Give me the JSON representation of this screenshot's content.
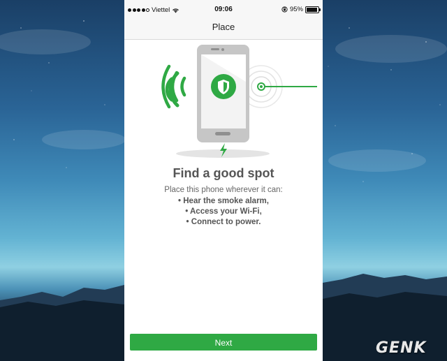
{
  "status_bar": {
    "carrier": "Viettel",
    "time": "09:06",
    "battery": "95%",
    "battery_level": 0.95,
    "icons": [
      "signal-dots-icon",
      "wifi-icon",
      "rotation-lock-icon",
      "battery-icon"
    ]
  },
  "nav": {
    "title": "Place"
  },
  "illustration": {
    "icons": [
      "phone-icon",
      "shield-icon",
      "wifi-waves-icon",
      "smoke-alarm-sound-icon",
      "power-bolt-icon"
    ],
    "accent": "#2fa944"
  },
  "content": {
    "heading": "Find a good spot",
    "subtext": "Place this phone wherever it can:",
    "requirements": [
      "Hear the smoke alarm,",
      "Access your Wi-Fi,",
      "Connect to power."
    ]
  },
  "button": {
    "next_label": "Next",
    "color": "#2fa944"
  },
  "watermark": {
    "text": "GENK"
  }
}
